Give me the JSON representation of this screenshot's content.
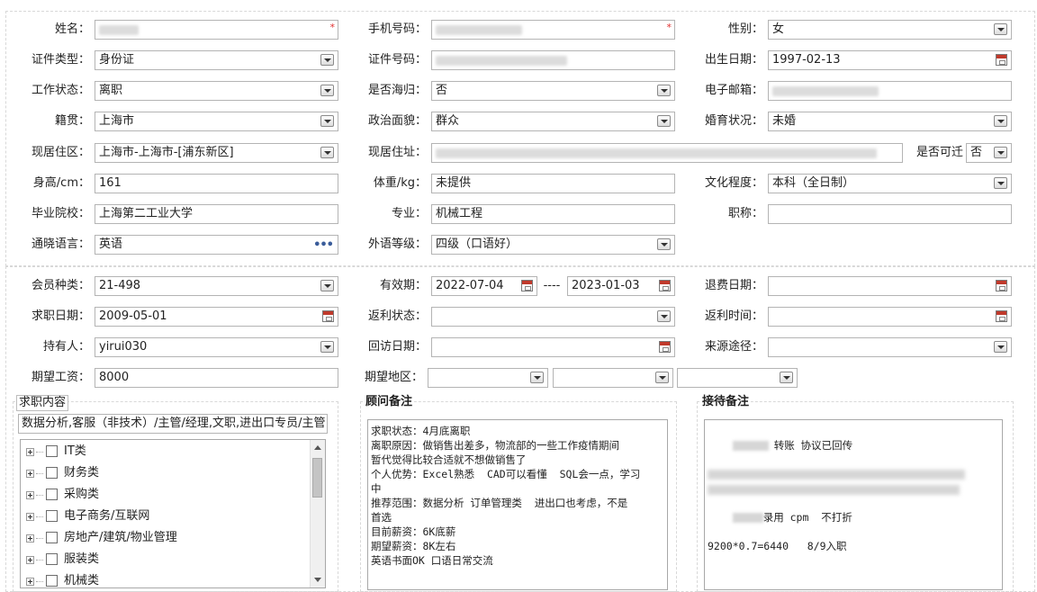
{
  "section1": {
    "name": {
      "label": "姓名："
    },
    "phone": {
      "label": "手机号码："
    },
    "gender": {
      "label": "性别：",
      "value": "女"
    },
    "id_type": {
      "label": "证件类型：",
      "value": "身份证"
    },
    "id_number": {
      "label": "证件号码："
    },
    "birth_date": {
      "label": "出生日期：",
      "value": "1997-02-13"
    },
    "work_status": {
      "label": "工作状态：",
      "value": "离职"
    },
    "overseas_returnee": {
      "label": "是否海归：",
      "value": "否"
    },
    "email": {
      "label": "电子邮箱："
    },
    "native_place": {
      "label": "籍贯：",
      "value": "上海市"
    },
    "political_status": {
      "label": "政治面貌：",
      "value": "群众"
    },
    "marital_status": {
      "label": "婚育状况：",
      "value": "未婚"
    },
    "current_area": {
      "label": "现居住区：",
      "value": "上海市-上海市-[浦东新区]"
    },
    "current_address": {
      "label": "现居住址："
    },
    "relocatable": {
      "label": "是否可迁",
      "value": "否"
    },
    "height": {
      "label": "身高/cm：",
      "value": "161"
    },
    "weight": {
      "label": "体重/kg：",
      "value": "未提供"
    },
    "education": {
      "label": "文化程度：",
      "value": "本科（全日制）"
    },
    "school": {
      "label": "毕业院校：",
      "value": "上海第二工业大学"
    },
    "major": {
      "label": "专业：",
      "value": "机械工程"
    },
    "title": {
      "label": "职称：",
      "value": ""
    },
    "languages": {
      "label": "通晓语言：",
      "value": "英语"
    },
    "foreign_level": {
      "label": "外语等级：",
      "value": "四级（口语好）"
    }
  },
  "section2": {
    "member_type": {
      "label": "会员种类：",
      "value": "21-498"
    },
    "validity": {
      "label": "有效期：",
      "start": "2022-07-04",
      "separator": "----",
      "end": "2023-01-03"
    },
    "refund_date": {
      "label": "退费日期：",
      "value": ""
    },
    "job_seek_date": {
      "label": "求职日期：",
      "value": "2009-05-01"
    },
    "rebate_status": {
      "label": "返利状态：",
      "value": ""
    },
    "rebate_time": {
      "label": "返利时间：",
      "value": ""
    },
    "holder": {
      "label": "持有人：",
      "value": "yirui030"
    },
    "revisit_date": {
      "label": "回访日期：",
      "value": ""
    },
    "source": {
      "label": "来源途径：",
      "value": ""
    },
    "expected_salary": {
      "label": "期望工资：",
      "value": "8000"
    },
    "expected_region": {
      "label": "期望地区：",
      "values": [
        "",
        "",
        ""
      ]
    }
  },
  "job_content": {
    "title": "求职内容",
    "summary": "数据分析,客服（非技术）/主管/经理,文职,进出口专员/主管",
    "categories": [
      "IT类",
      "财务类",
      "采购类",
      "电子商务/互联网",
      "房地产/建筑/物业管理",
      "服装类",
      "机械类"
    ]
  },
  "consultant_notes": {
    "title": "顾问备注",
    "lines": [
      "求职状态：4月底离职",
      "离职原因：做销售出差多，物流部的一些工作疫情期间",
      "暂代觉得比较合适就不想做销售了",
      "个人优势：Excel熟悉  CAD可以看懂  SQL会一点，学习",
      "中",
      "推荐范围：数据分析 订单管理类  进出口也考虑，不是",
      "首选",
      "目前薪资：6K底薪",
      "期望薪资：8K左右",
      "英语书面OK 口语日常交流"
    ]
  },
  "reception_notes": {
    "title": "接待备注",
    "line1": "转账 协议已回传",
    "line3": "录用 cpm  不打折",
    "line4": "9200*0.7=6440   8/9入职"
  }
}
